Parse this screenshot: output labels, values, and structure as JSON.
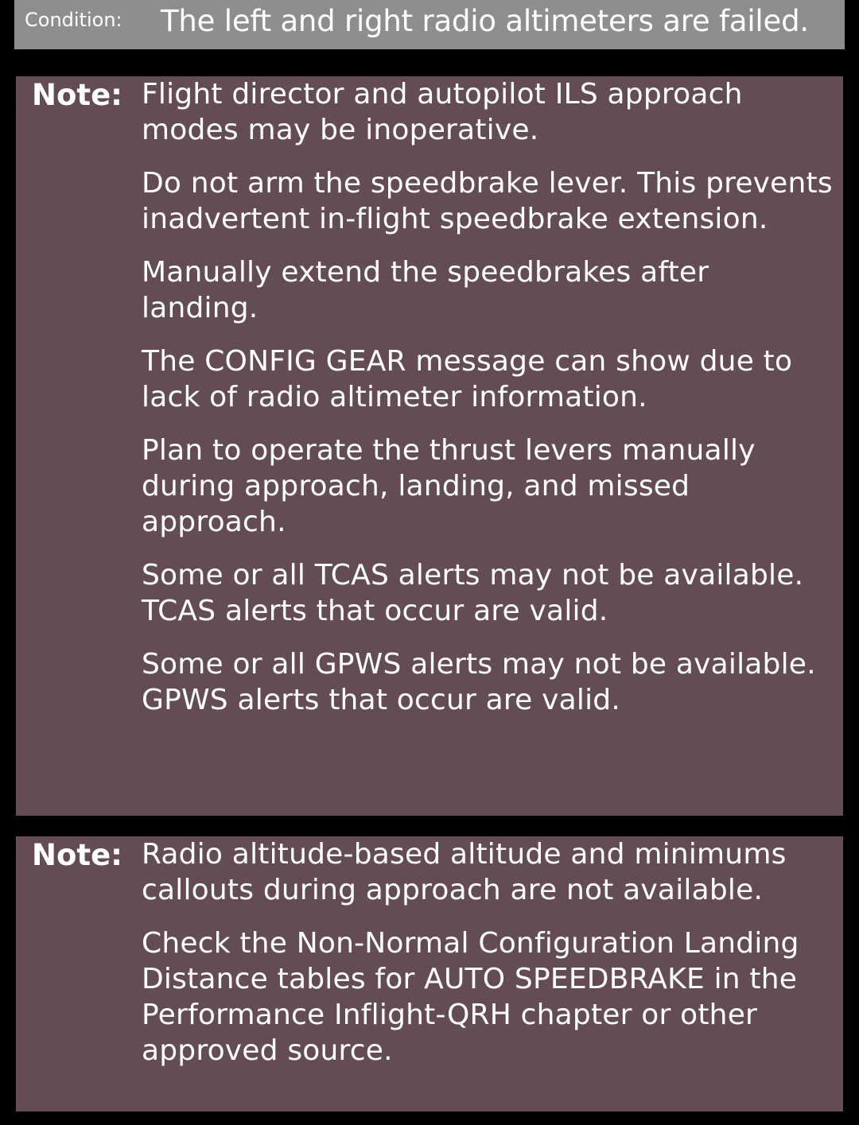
{
  "condition": {
    "label": "Condition:",
    "text": "The left and right radio altimeters are failed."
  },
  "notes": [
    {
      "label": "Note:",
      "paragraphs": [
        "Flight director and autopilot ILS approach modes may be inoperative.",
        "Do not arm the speedbrake lever. This prevents inadvertent in-flight speedbrake extension.",
        "Manually extend the speedbrakes after landing.",
        "The CONFIG GEAR message can show due to lack of radio altimeter information.",
        "Plan to operate the thrust levers manually during approach, landing, and missed approach.",
        "Some or all TCAS alerts may not be available. TCAS alerts that occur are valid.",
        "Some or all GPWS alerts may not be available. GPWS alerts that occur are valid."
      ]
    },
    {
      "label": "Note:",
      "paragraphs": [
        "Radio altitude-based altitude and minimums callouts during approach are not available.",
        "Check the Non-Normal Configuration Landing Distance tables for AUTO SPEEDBRAKE in the Performance Inflight-QRH chapter or other approved source."
      ]
    }
  ],
  "colors": {
    "background": "#000000",
    "condition_bar": "#8e8e8e",
    "note_box": "#634d53",
    "text": "#ffffff"
  }
}
